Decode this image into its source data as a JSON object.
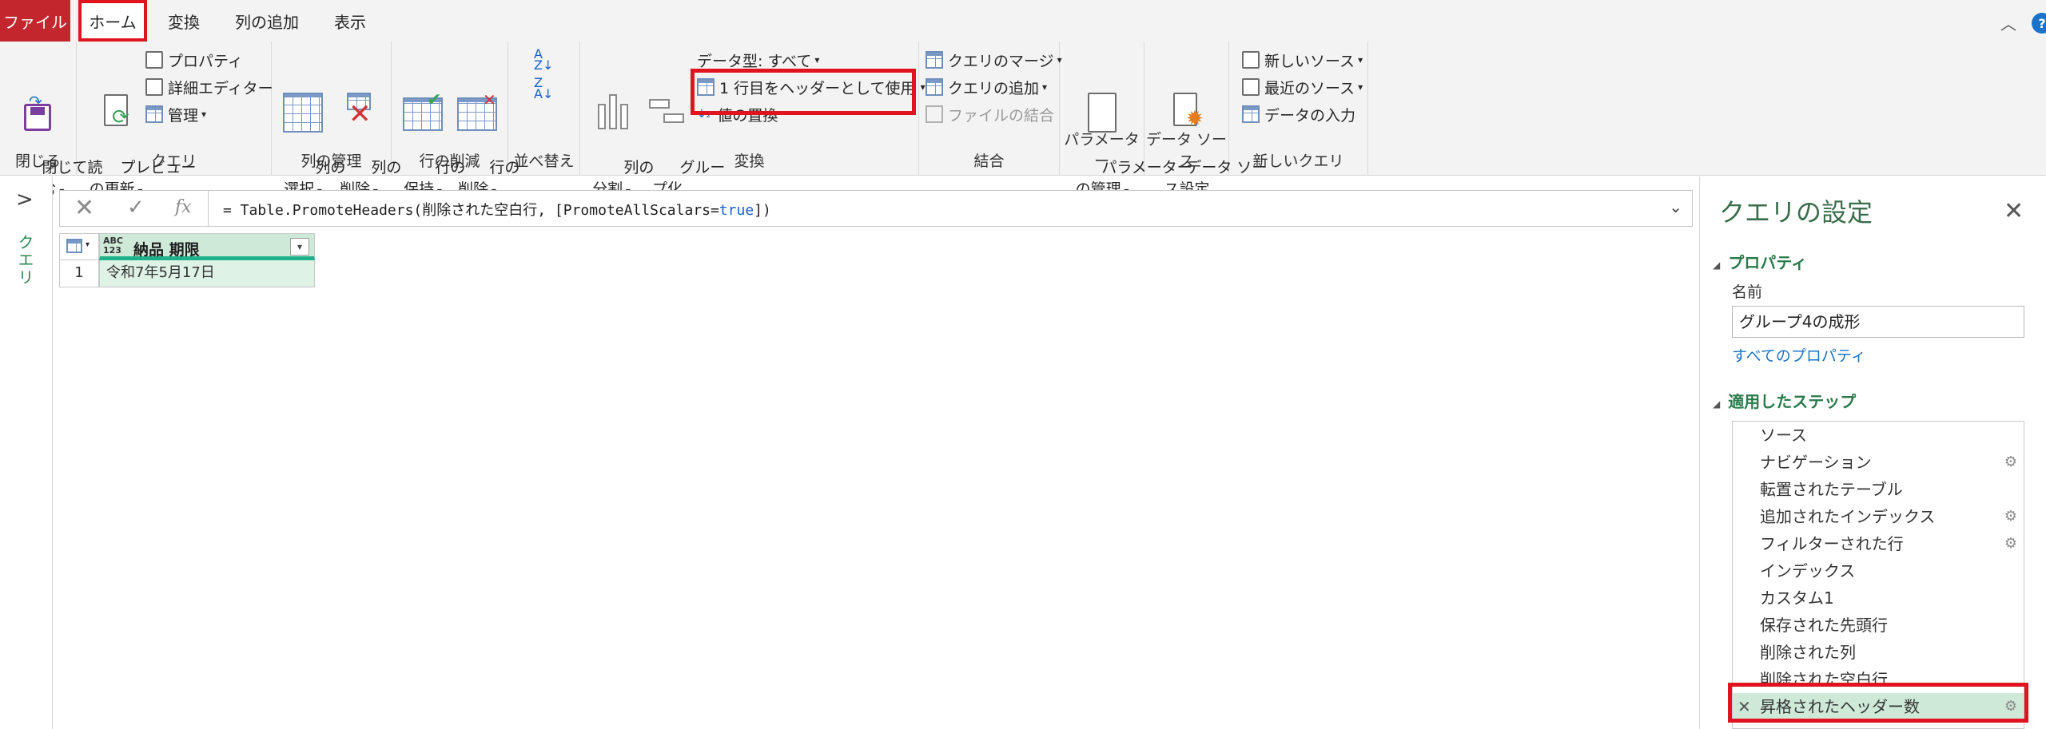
{
  "tabs": {
    "file": "ファイル",
    "home": "ホーム",
    "transform": "変換",
    "add_column": "列の追加",
    "view": "表示"
  },
  "ribbon": {
    "close": {
      "button": "閉じて読\nみ込む",
      "label": "閉じる"
    },
    "query": {
      "preview": "プレビュー\nの更新",
      "properties": "プロパティ",
      "advanced_editor": "詳細エディター",
      "manage": "管理",
      "label": "クエリ"
    },
    "manage_columns": {
      "choose": "列の\n選択",
      "remove": "列の\n削除",
      "label": "列の管理"
    },
    "reduce_rows": {
      "keep": "行の\n保持",
      "remove": "行の\n削除",
      "label": "行の削減"
    },
    "sort": {
      "label": "並べ替え"
    },
    "transform": {
      "split": "列の\n分割",
      "group": "グルー\nプ化",
      "data_type": "データ型: すべて",
      "use_first_row": "1 行目をヘッダーとして使用",
      "replace_values": "値の置換",
      "label": "変換"
    },
    "combine": {
      "merge": "クエリのマージ",
      "append": "クエリの追加",
      "combine_files": "ファイルの結合",
      "label": "結合"
    },
    "parameters": {
      "manage": "パラメーター\nの管理",
      "label": "パラメーター"
    },
    "data_source": {
      "settings": "データ ソー\nス設定",
      "label": "データ ソース"
    },
    "new_query": {
      "new_source": "新しいソース",
      "recent": "最近のソース",
      "enter_data": "データの入力",
      "label": "新しいクエリ"
    }
  },
  "left_pane": {
    "label": "クエリ"
  },
  "formula": {
    "prefix": "= Table.PromoteHeaders(削除された空白行, [PromoteAllScalars=",
    "keyword": "true",
    "suffix": "])"
  },
  "table": {
    "type_icon_top": "ABC",
    "type_icon_bottom": "123",
    "column": "納品 期限",
    "row_number": "1",
    "cell": "令和7年5月17日"
  },
  "settings": {
    "title": "クエリの設定",
    "properties_section": "プロパティ",
    "name_label": "名前",
    "name_value": "グループ4の成形",
    "all_properties": "すべてのプロパティ",
    "steps_section": "適用したステップ",
    "steps": [
      {
        "label": "ソース",
        "gear": false
      },
      {
        "label": "ナビゲーション",
        "gear": true
      },
      {
        "label": "転置されたテーブル",
        "gear": false
      },
      {
        "label": "追加されたインデックス",
        "gear": true
      },
      {
        "label": "フィルターされた行",
        "gear": true
      },
      {
        "label": "インデックス",
        "gear": false
      },
      {
        "label": "カスタム1",
        "gear": false
      },
      {
        "label": "保存された先頭行",
        "gear": false
      },
      {
        "label": "削除された列",
        "gear": false
      },
      {
        "label": "削除された空白行",
        "gear": false
      },
      {
        "label": "昇格されたヘッダー数",
        "gear": true,
        "selected": true
      }
    ]
  },
  "colors": {
    "file_tab": "#c4262e",
    "accent_green": "#2a7a4a",
    "highlight_red": "#e0141e",
    "selected_col": "#cfe9d8"
  }
}
